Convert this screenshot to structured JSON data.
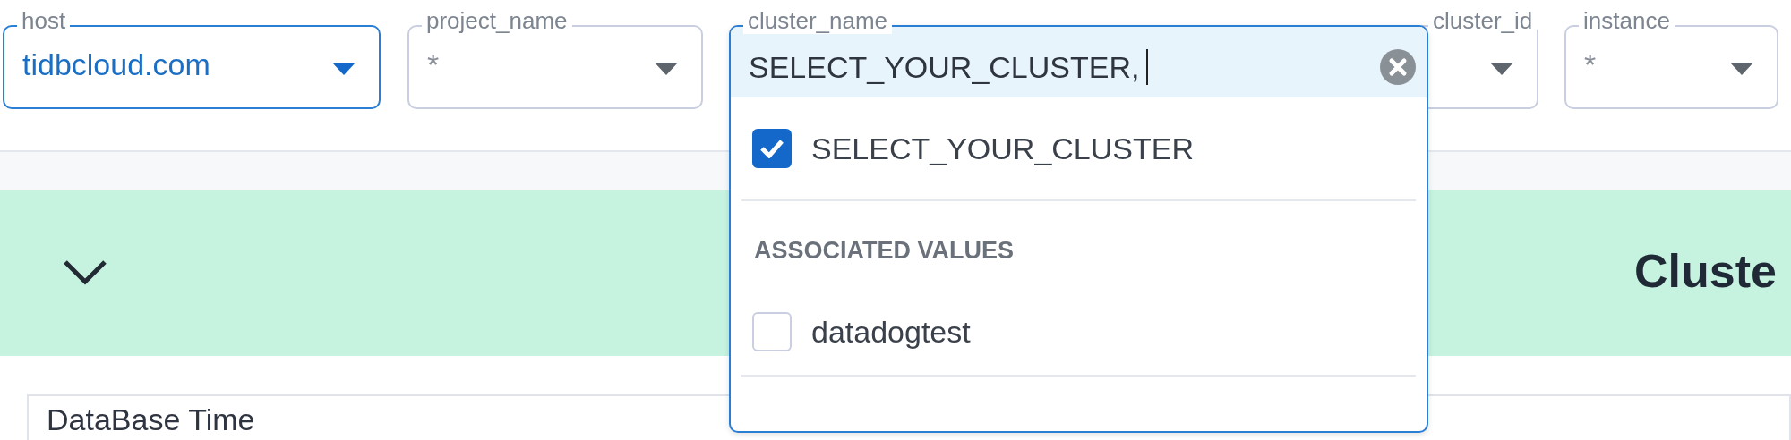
{
  "filters": [
    {
      "label": "host",
      "value": "tidbcloud.com",
      "active": true,
      "expanded": false
    },
    {
      "label": "project_name",
      "value": "*",
      "active": false,
      "expanded": false
    },
    {
      "label": "cluster_name",
      "active": false,
      "expanded": true,
      "input_value": "SELECT_YOUR_CLUSTER,",
      "options": [
        {
          "label": "SELECT_YOUR_CLUSTER",
          "checked": true
        }
      ],
      "groups": [
        {
          "title": "ASSOCIATED VALUES",
          "options": [
            {
              "label": "datadogtest",
              "checked": false
            }
          ]
        }
      ]
    },
    {
      "label": "cluster_id",
      "active": false,
      "expanded": false
    },
    {
      "label": "instance",
      "value": "*",
      "active": false,
      "expanded": false
    }
  ],
  "section": {
    "title": "Cluste",
    "expanded": true
  },
  "panel": {
    "title": "DataBase Time"
  }
}
